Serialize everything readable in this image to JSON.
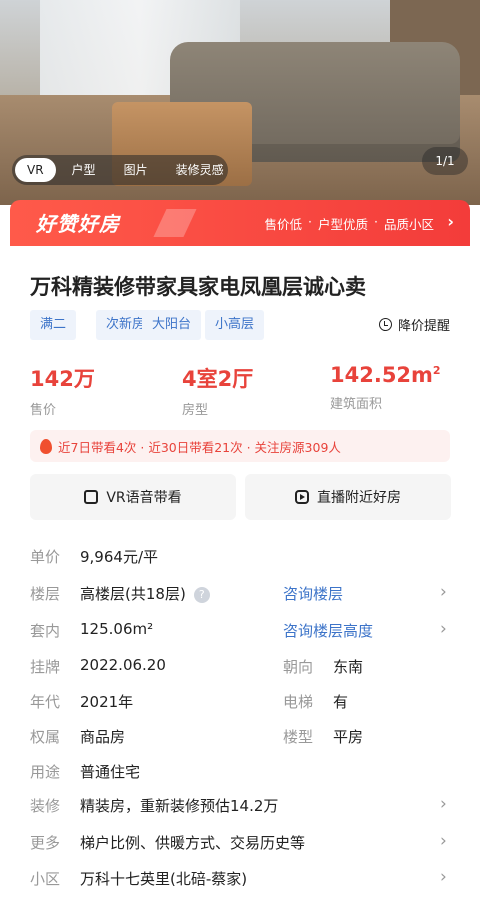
{
  "hero": {
    "tabs": [
      {
        "label": "VR"
      },
      {
        "label": "户型"
      },
      {
        "label": "图片"
      },
      {
        "label": "装修灵感"
      }
    ],
    "counter": "1/1"
  },
  "banner": {
    "badge": "好赞好房",
    "tags": [
      "售价低",
      "·",
      "户型优质",
      "·",
      "品质小区"
    ],
    "arrow": "›"
  },
  "listing": {
    "title": "万科精装修带家具家电凤凰层诚心卖",
    "tags": [
      "满二",
      "次新房",
      "大阳台",
      "小高层"
    ],
    "reminder": "降价提醒",
    "stats": [
      {
        "value": "142万",
        "label": "售价"
      },
      {
        "value": "4室2厅",
        "label": "房型"
      },
      {
        "value": "142.52m",
        "sup": "2",
        "label": "建筑面积"
      }
    ],
    "hot": "近7日带看4次 · 近30日带看21次 · 关注房源309人",
    "actions": [
      {
        "label": "VR语音带看",
        "icon": "vr-icon"
      },
      {
        "label": "直播附近好房",
        "icon": "live-icon"
      }
    ]
  },
  "details": {
    "unit_price": {
      "key": "单价",
      "value": "9,964元/平"
    },
    "floor": {
      "key": "楼层",
      "value": "高楼层(共18层)",
      "help": "?",
      "link": "咨询楼层"
    },
    "inner": {
      "key": "套内",
      "value": "125.06m²",
      "link": "咨询楼层高度"
    },
    "listed": {
      "key": "挂牌",
      "value": "2022.06.20",
      "key2": "朝向",
      "value2": "东南"
    },
    "year": {
      "key": "年代",
      "value": "2021年",
      "key2": "电梯",
      "value2": "有"
    },
    "ownership": {
      "key": "权属",
      "value": "商品房",
      "key2": "楼型",
      "value2": "平房"
    },
    "usage": {
      "key": "用途",
      "value": "普通住宅"
    },
    "decoration": {
      "key": "装修",
      "value": "精装房，重新装修预估14.2万"
    },
    "more": {
      "key": "更多",
      "value": "梯户比例、供暖方式、交易历史等"
    },
    "community": {
      "key": "小区",
      "value": "万科十七英里(北碚-蔡家)"
    },
    "chevron": "›"
  },
  "colors": {
    "accent": "#e8433b",
    "link": "#3d74c9",
    "banner": "#f33c3a"
  }
}
